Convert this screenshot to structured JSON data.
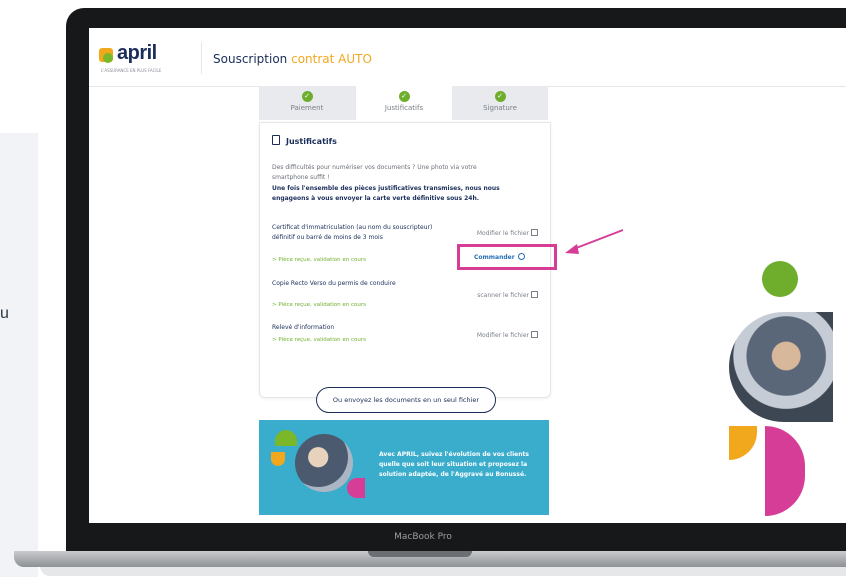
{
  "left_panel": {
    "letter": "u"
  },
  "device": {
    "label": "MacBook Pro"
  },
  "header": {
    "logo_word": "april",
    "logo_tagline": "L'ASSURANCE EN PLUS FACILE",
    "title_part1": "Souscription ",
    "title_part2": "contrat AUTO"
  },
  "steps": [
    {
      "label": "Paiement",
      "done": true
    },
    {
      "label": "Justificatifs",
      "done": true
    },
    {
      "label": "Signature",
      "done": true
    }
  ],
  "card": {
    "title": "Justificatifs",
    "intro": "Des difficultés pour numériser vos documents ? Une photo via votre smartphone suffit !",
    "intro_bold": "Une fois l'ensemble des pièces justificatives transmises, nous nous engageons à vous envoyer la carte verte définitive sous 24h.",
    "documents": [
      {
        "name": "Certificat d'immatriculation (au nom du souscripteur) définitif ou barré de moins de 3 mois",
        "action": "Modifier le fichier",
        "status": "> Pièce reçue, validation en cours"
      },
      {
        "name": "Copie Recto Verso du permis de conduire",
        "action": "scanner le fichier",
        "status": "> Pièce reçue, validation en cours"
      },
      {
        "name": "Relevé d'information",
        "action": "Modifier le fichier",
        "status": "> Pièce reçue, validation en cours"
      }
    ],
    "commander_label": "Commander",
    "single_file_button": "Ou envoyez les documents en un seul fichier"
  },
  "banner": {
    "text": "Avec APRIL, suivez l'évolution de vos clients quelle que soit leur situation et proposez la solution adaptée, de l'Aggravé au Bonussé."
  },
  "colors": {
    "brand_navy": "#1b2e5a",
    "accent_orange": "#f2a81d",
    "green": "#6fae2d",
    "pink": "#d63d96",
    "banner_blue": "#3aaccc"
  }
}
